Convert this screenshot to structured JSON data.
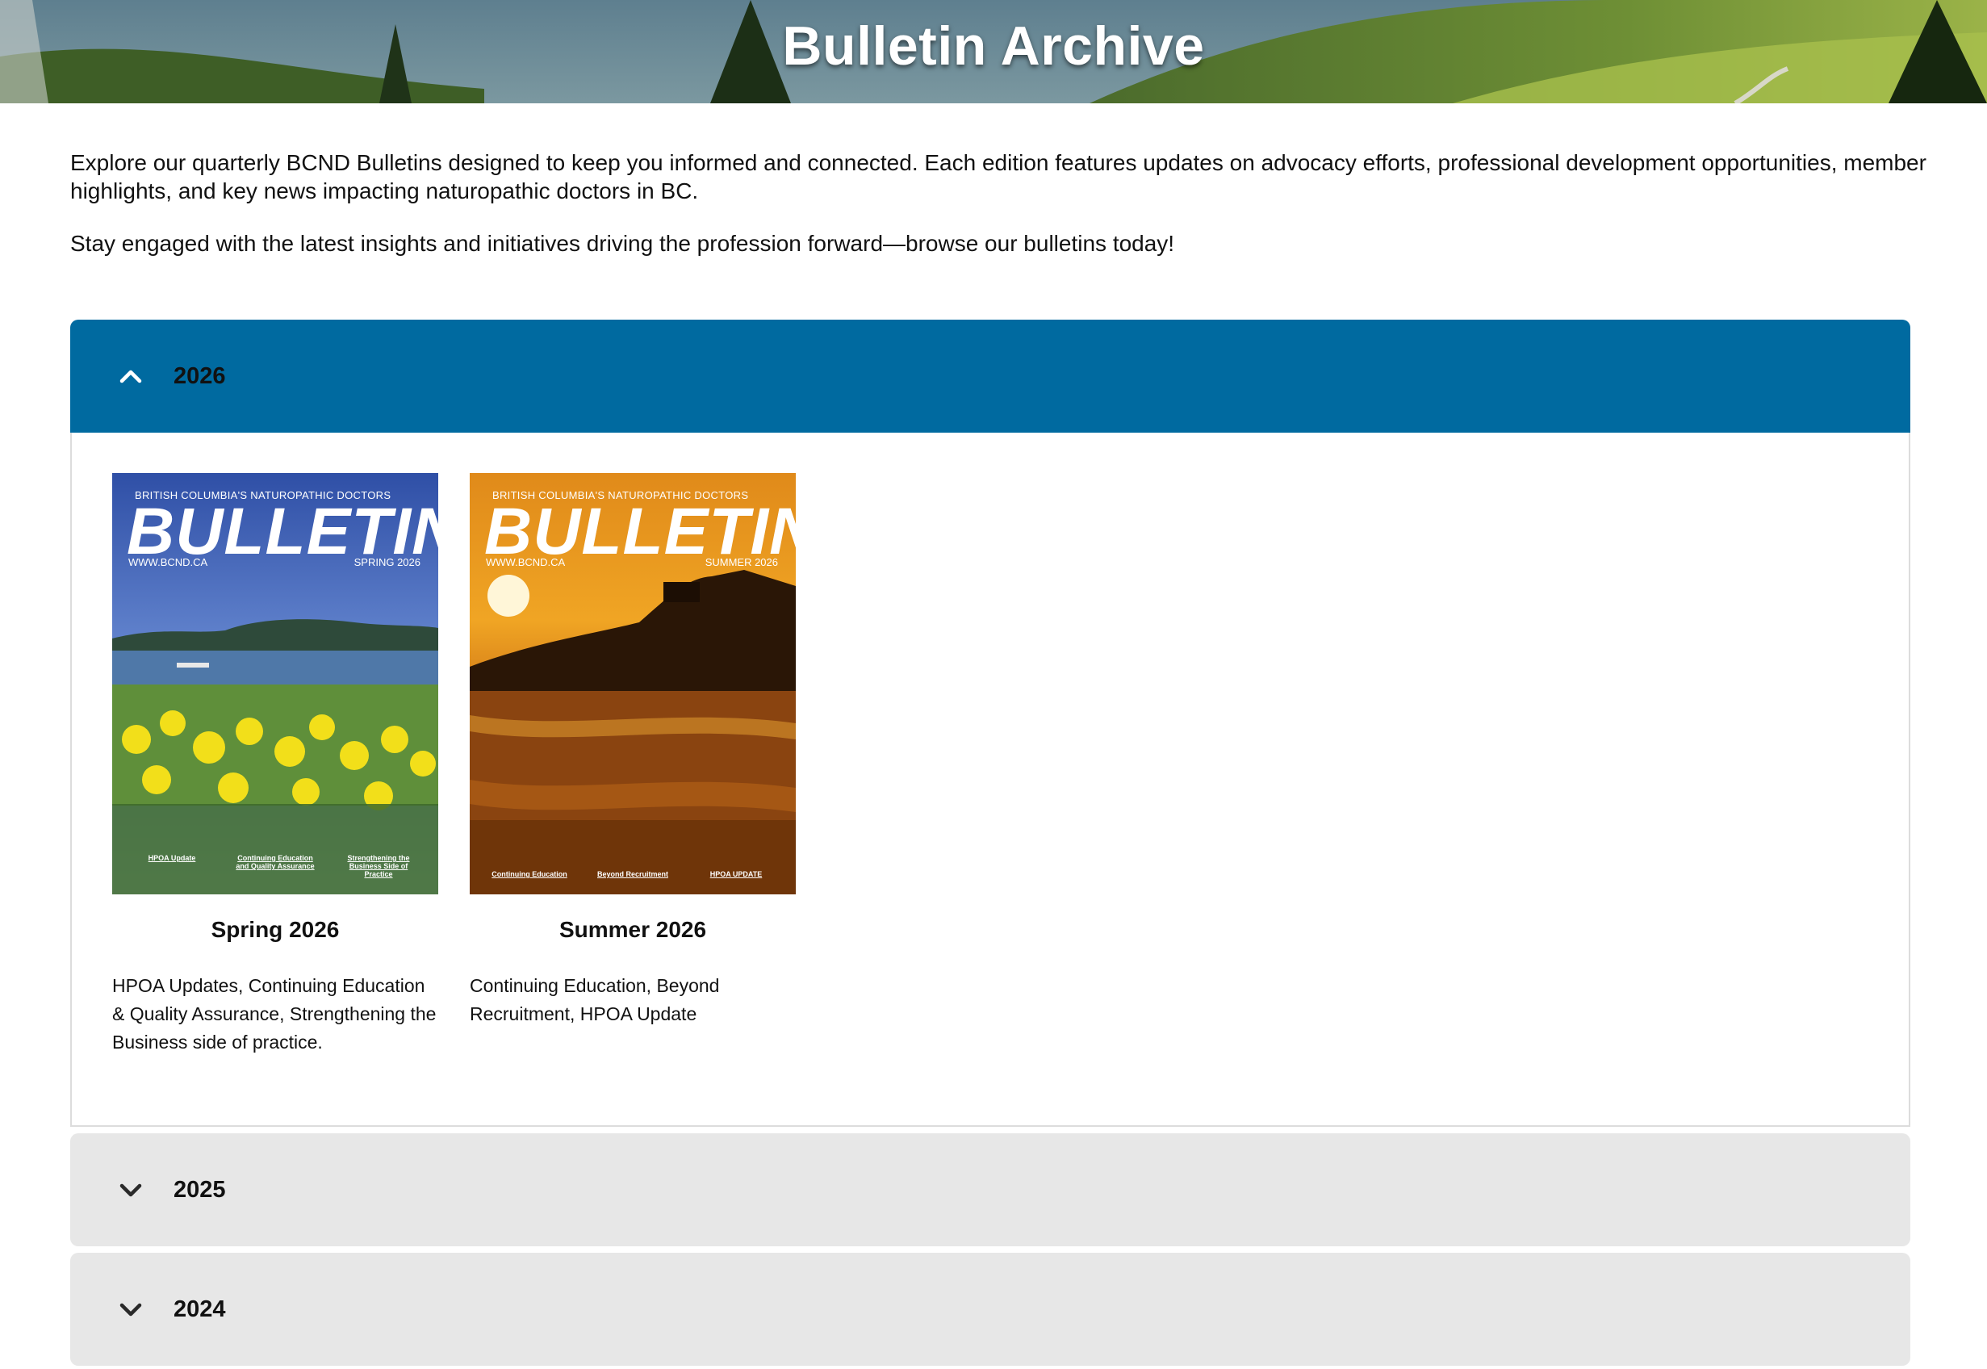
{
  "page": {
    "title": "Bulletin Archive",
    "intro": [
      "Explore our quarterly BCND Bulletins designed to keep you informed and connected. Each edition features updates on advocacy efforts, professional development opportunities, member highlights, and key news impacting naturopathic doctors in BC.",
      "Stay engaged with the latest insights and initiatives driving the profession forward—browse our bulletins today!"
    ]
  },
  "accordion": [
    {
      "year": "2026",
      "expanded": true,
      "bulletins": [
        {
          "title": "Spring 2026",
          "description": "HPOA Updates, Continuing Education & Quality Assurance, Strengthening the Business side of practice.",
          "cover": {
            "header": "BRITISH COLUMBIA'S NATUROPATHIC DOCTORS",
            "masthead": "BULLETIN",
            "url": "WWW.BCND.CA",
            "edition": "SPRING 2026",
            "topics": [
              "HPOA Update",
              "Continuing Education and Quality Assurance",
              "Strengthening the Business Side of Practice"
            ],
            "theme": "daffodils-lake"
          }
        },
        {
          "title": "Summer 2026",
          "description": "Continuing Education, Beyond Recruitment, HPOA Update",
          "cover": {
            "header": "BRITISH COLUMBIA'S NATUROPATHIC DOCTORS",
            "masthead": "BULLETIN",
            "url": "WWW.BCND.CA",
            "edition": "SUMMER 2026",
            "topics": [
              "Continuing Education",
              "Beyond Recruitment",
              "HPOA UPDATE"
            ],
            "theme": "sunset-beach"
          }
        }
      ]
    },
    {
      "year": "2025",
      "expanded": false
    },
    {
      "year": "2024",
      "expanded": false
    }
  ],
  "icons": {
    "expanded": "chevron-up-icon",
    "collapsed": "chevron-down-icon"
  },
  "colors": {
    "accordion_open": "#006aa0",
    "accordion_closed": "#e7e7e7"
  }
}
